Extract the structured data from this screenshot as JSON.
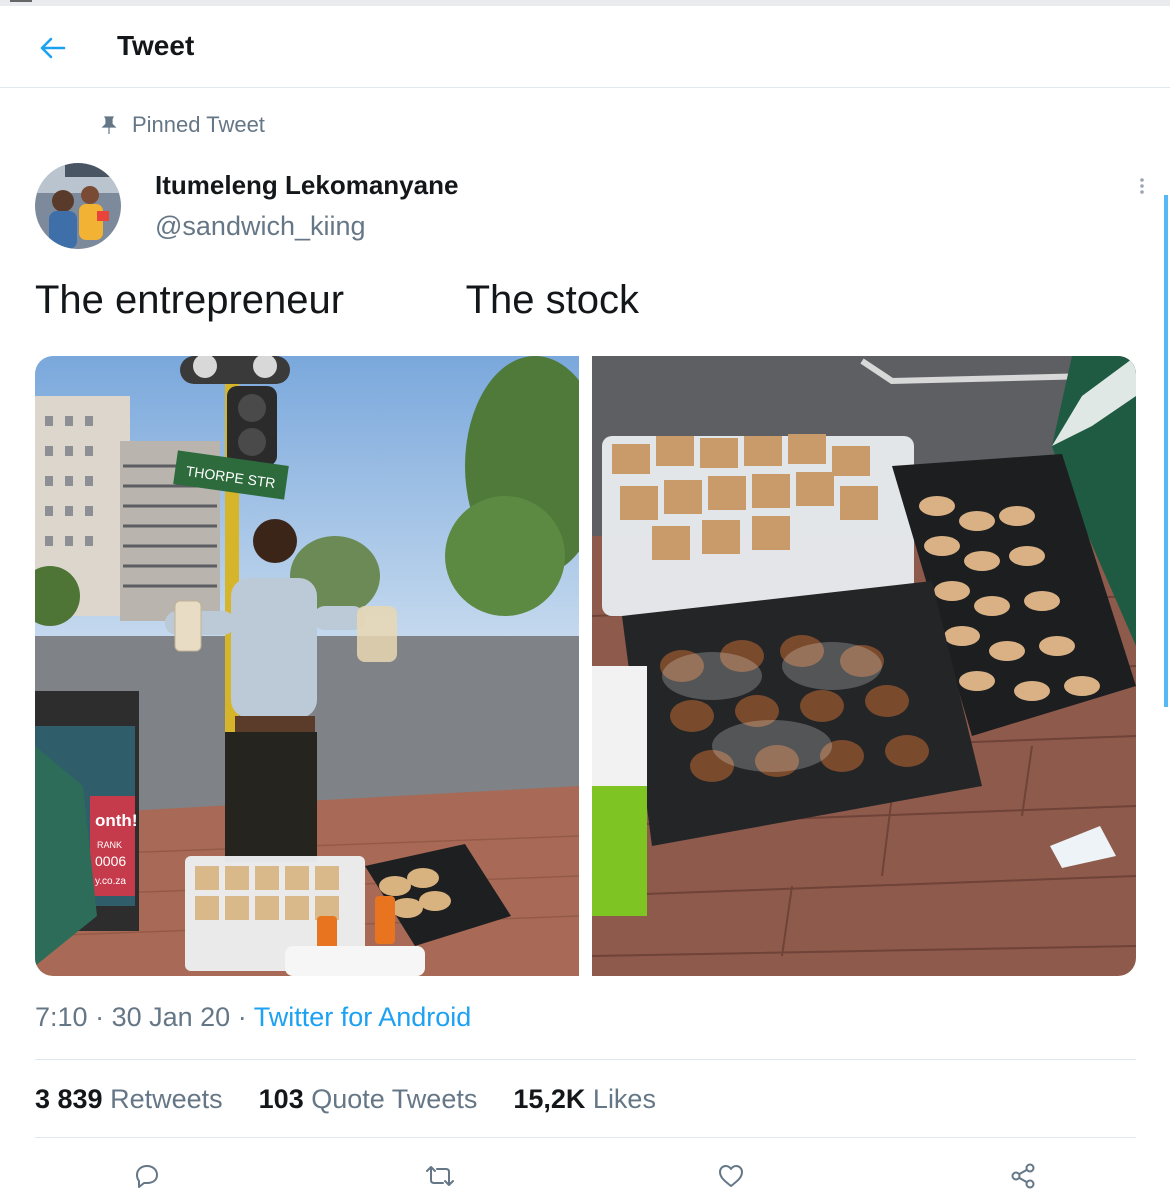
{
  "header": {
    "title": "Tweet",
    "back_icon": "arrow-left-icon"
  },
  "pinned": {
    "label": "Pinned Tweet",
    "icon": "pin-icon"
  },
  "author": {
    "name": "Itumeleng Lekomanyane",
    "handle": "@sandwich_kiing"
  },
  "tweet": {
    "text": "The entrepreneur           The stock",
    "media": [
      {
        "sign_text": "THORPE STR",
        "ad_text": [
          "onth!",
          "RANK",
          "0006",
          "y.co.za"
        ]
      },
      {
        "alt": "photo"
      }
    ]
  },
  "meta": {
    "time": "7:10",
    "date": "30 Jan 20",
    "source": "Twitter for Android"
  },
  "stats": {
    "retweets_count": "3 839",
    "retweets_label": "Retweets",
    "quotes_count": "103",
    "quotes_label": "Quote Tweets",
    "likes_count": "15,2K",
    "likes_label": "Likes"
  },
  "actions": [
    "reply-icon",
    "retweet-icon",
    "like-icon",
    "share-icon"
  ],
  "colors": {
    "accent": "#1da1f2",
    "secondary_text": "#657786",
    "primary_text": "#14171a",
    "divider": "#e1e8ed"
  }
}
